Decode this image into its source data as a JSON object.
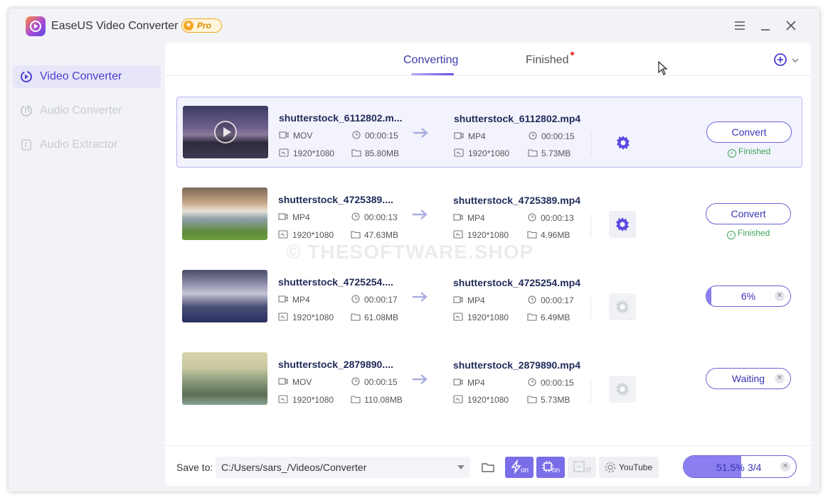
{
  "app": {
    "title": "EaseUS Video Converter",
    "badge": "Pro"
  },
  "sidebar": {
    "items": [
      {
        "label": "Video Converter",
        "state": "active"
      },
      {
        "label": "Audio Converter",
        "state": "inactive"
      },
      {
        "label": "Audio Extractor",
        "state": "inactive"
      }
    ]
  },
  "tabs": {
    "converting": "Converting",
    "finished": "Finished"
  },
  "files": [
    {
      "src_name": "shutterstock_6112802.m...",
      "src_format": "MOV",
      "src_duration": "00:00:15",
      "src_resolution": "1920*1080",
      "src_size": "85.80MB",
      "dst_name": "shutterstock_6112802.mp4",
      "dst_format": "MP4",
      "dst_duration": "00:00:15",
      "dst_resolution": "1920*1080",
      "dst_size": "5.73MB",
      "action": "Convert",
      "status": "Finished"
    },
    {
      "src_name": "shutterstock_4725389....",
      "src_format": "MP4",
      "src_duration": "00:00:13",
      "src_resolution": "1920*1080",
      "src_size": "47.63MB",
      "dst_name": "shutterstock_4725389.mp4",
      "dst_format": "MP4",
      "dst_duration": "00:00:13",
      "dst_resolution": "1920*1080",
      "dst_size": "4.96MB",
      "action": "Convert",
      "status": "Finished"
    },
    {
      "src_name": "shutterstock_4725254....",
      "src_format": "MP4",
      "src_duration": "00:00:17",
      "src_resolution": "1920*1080",
      "src_size": "61.08MB",
      "dst_name": "shutterstock_4725254.mp4",
      "dst_format": "MP4",
      "dst_duration": "00:00:17",
      "dst_resolution": "1920*1080",
      "dst_size": "6.49MB",
      "action": "6%",
      "progress": 0.06
    },
    {
      "src_name": "shutterstock_2879890....",
      "src_format": "MOV",
      "src_duration": "00:00:15",
      "src_resolution": "1920*1080",
      "src_size": "110.08MB",
      "dst_name": "shutterstock_2879890.mp4",
      "dst_format": "MP4",
      "dst_duration": "00:00:15",
      "dst_resolution": "1920*1080",
      "dst_size": "5.73MB",
      "action": "Waiting"
    }
  ],
  "bottom": {
    "save_label": "Save to:",
    "save_path": "C:/Users/sars_/Videos/Converter",
    "gpu_state": "on",
    "hw_state": "on",
    "merge_state": "off",
    "youtube_label": "YouTube",
    "total_progress": "51.5%",
    "total_progress_value": 0.515,
    "total_count": "3/4"
  },
  "watermark": "© THESOFTWARE.SHOP",
  "colors": {
    "accent": "#6a5be2",
    "finished": "#3da55a",
    "badge": "#f0a81f"
  }
}
